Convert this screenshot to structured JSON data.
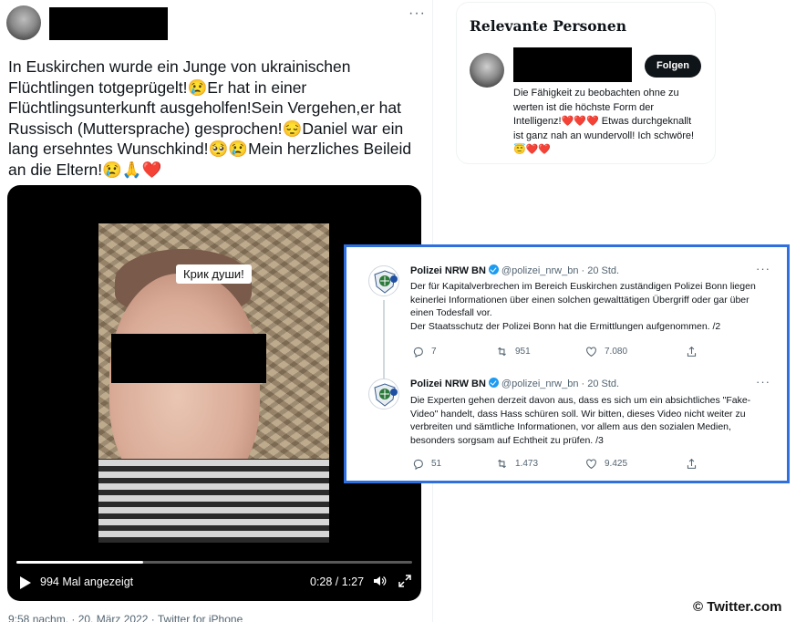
{
  "main_tweet": {
    "text": "In Euskirchen wurde ein Junge von ukrainischen Flüchtlingen totgeprügelt!😢Er hat in einer Flüchtlingsunterkunft ausgeholfen!Sein Vergehen,er hat Russisch (Muttersprache) gesprochen!😔Daniel war ein lang ersehntes Wunschkind!🥺😢Mein herzliches Beileid an die Eltern!😢🙏❤️",
    "video": {
      "caption_tag": "Крик души!",
      "views": "994 Mal angezeigt",
      "timecode": "0:28 / 1:27",
      "progress_fraction": 0.32
    },
    "meta": "9:58 nachm. · 20. März 2022 · Twitter for iPhone"
  },
  "persons": {
    "title": "Relevante Personen",
    "follow_label": "Folgen",
    "bio": "Die Fähigkeit zu beobachten ohne zu werten ist die höchste Form der Intelligenz!❤️❤️❤️ Etwas durchgeknallt ist ganz nah an wundervoll! Ich schwöre!😇❤️❤️"
  },
  "police_tweets": [
    {
      "name": "Polizei NRW BN",
      "handle": "@polizei_nrw_bn · 20 Std.",
      "text": "Der für Kapitalverbrechen im Bereich Euskirchen zuständigen Polizei Bonn liegen keinerlei Informationen über einen solchen gewalttätigen Übergriff oder gar über einen Todesfall vor.\nDer Staatsschutz der Polizei Bonn hat die Ermittlungen aufgenommen. /2",
      "replies": "7",
      "retweets": "951",
      "likes": "7.080"
    },
    {
      "name": "Polizei NRW BN",
      "handle": "@polizei_nrw_bn · 20 Std.",
      "text": "Die Experten gehen derzeit davon aus, dass es sich um ein absichtliches \"Fake-Video\" handelt, dass Hass schüren soll. Wir bitten, dieses Video nicht weiter zu verbreiten und sämtliche Informationen, vor allem aus den sozialen Medien, besonders sorgsam auf Echtheit zu prüfen. /3",
      "replies": "51",
      "retweets": "1.473",
      "likes": "9.425"
    }
  ],
  "watermark": "© Twitter.com",
  "colors": {
    "accent_border": "#2f6fde",
    "verified": "#1d9bf0",
    "heart": "#e0245e",
    "text_secondary": "#536471"
  },
  "icons": [
    "more-icon",
    "play-icon",
    "volume-icon",
    "fullscreen-icon",
    "reply-icon",
    "retweet-icon",
    "like-icon",
    "share-icon",
    "verified-icon"
  ]
}
